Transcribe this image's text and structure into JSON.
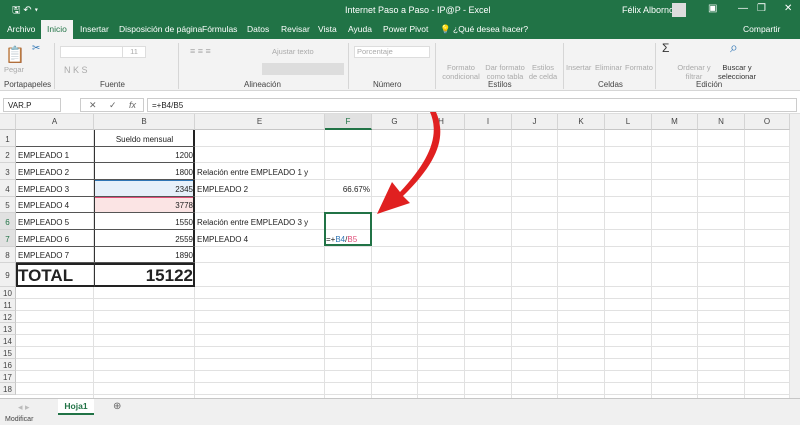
{
  "window": {
    "title": "Internet Paso a Paso - IP@P  -  Excel",
    "user": "Félix Albornoz"
  },
  "tabs": [
    "Archivo",
    "Inicio",
    "Insertar",
    "Disposición de página",
    "Fórmulas",
    "Datos",
    "Revisar",
    "Vista",
    "Ayuda",
    "Power Pivot"
  ],
  "tell_me": "¿Qué desea hacer?",
  "share": "Compartir",
  "ribbon": {
    "groups": [
      "Portapapeles",
      "Fuente",
      "Alineación",
      "Número",
      "Estilos",
      "Celdas",
      "Edición"
    ],
    "paste": "Pegar",
    "wrap": "Ajustar texto",
    "number_format": "Porcentaje",
    "font_size": "11",
    "cond_format": "Formato condicional",
    "format_table": "Dar formato como tabla",
    "cell_styles": "Estilos de celda",
    "insert": "Insertar",
    "delete": "Eliminar",
    "format": "Formato",
    "sort": "Ordenar y filtrar",
    "find": "Buscar y seleccionar"
  },
  "formula_bar": {
    "name_box": "VAR.P",
    "formula": "=+B4/B5"
  },
  "columns": [
    "A",
    "B",
    "E",
    "F",
    "G",
    "H",
    "I",
    "J",
    "K",
    "L",
    "M",
    "N",
    "O"
  ],
  "rows": [
    "1",
    "2",
    "3",
    "4",
    "5",
    "6",
    "7",
    "8",
    "9",
    "10",
    "11",
    "12",
    "13",
    "14",
    "15",
    "16",
    "17",
    "18"
  ],
  "cells": {
    "B1": "Sueldo mensual",
    "A2": "EMPLEADO 1",
    "B2": "1200",
    "A3": "EMPLEADO 2",
    "B3": "1800",
    "E3": "Relación entre EMPLEADO 1 y",
    "A4": "EMPLEADO 3",
    "B4": "2345",
    "E4": "EMPLEADO 2",
    "F4": "66.67%",
    "A5": "EMPLEADO 4",
    "B5": "3778",
    "A6": "EMPLEADO 5",
    "B6": "1550",
    "E6": "Relación entre EMPLEADO 3 y",
    "A7": "EMPLEADO 6",
    "B7": "2559",
    "E7": "EMPLEADO 4",
    "A8": "EMPLEADO 7",
    "B8": "1890",
    "A9": "TOTAL",
    "B9": "15122"
  },
  "edit_formula": {
    "prefix": "=+",
    "ref1": "B4",
    "slash": "/",
    "ref2": "B5"
  },
  "sheet_tab": "Hoja1",
  "status": "Modificar",
  "colors": {
    "excel_green": "#217346",
    "ref1": "#2f75b5",
    "ref2": "#e0507a",
    "arrow": "#e02020"
  }
}
